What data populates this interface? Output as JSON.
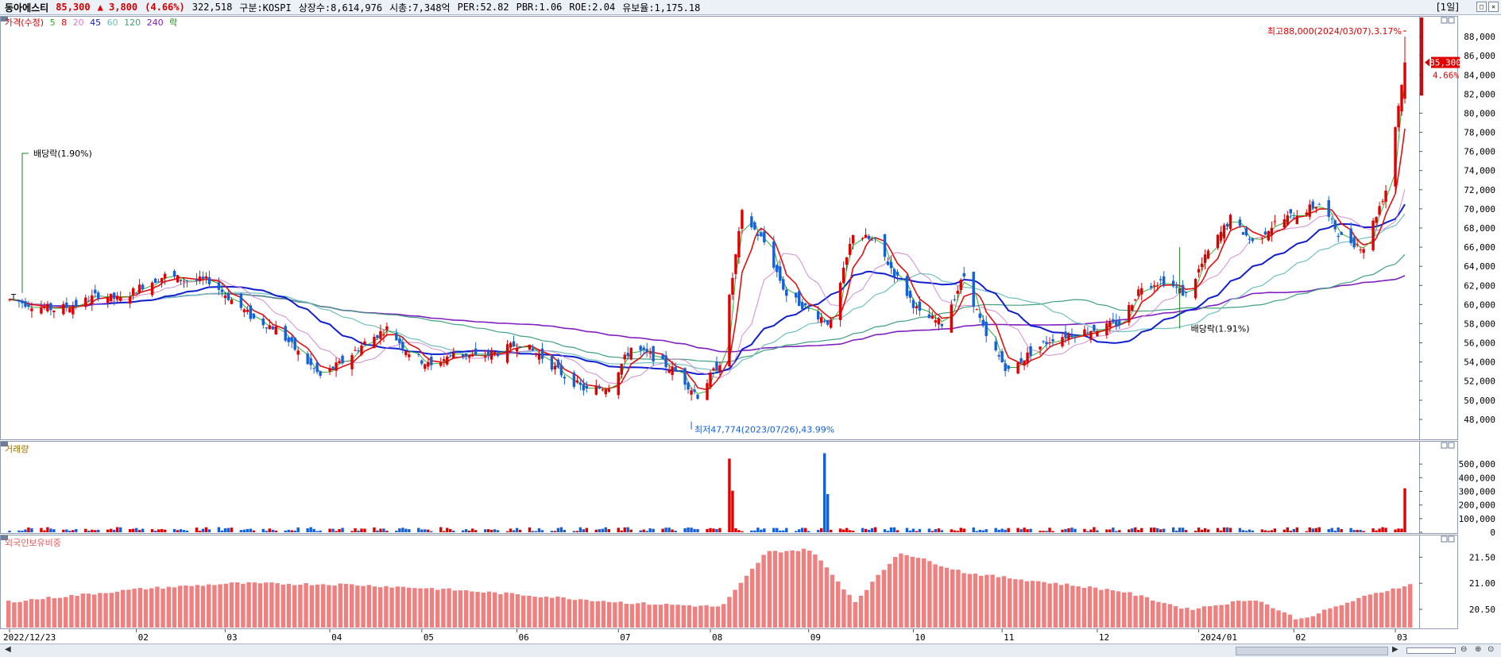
{
  "header": {
    "stock_name": "동아에스티",
    "price": "85,300",
    "change": "▲ 3,800",
    "change_pct": "(4.66%)",
    "volume": "322,518",
    "market": "구분:KOSPI",
    "shares": "상장수:8,614,976",
    "mktcap": "시총:7,348억",
    "per": "PER:52.82",
    "pbr": "PBR:1.06",
    "roe": "ROE:2.04",
    "float": "유보율:1,175.18",
    "period": "[1일]"
  },
  "legend": {
    "price_label": "가격(수정)",
    "ma5": "5",
    "ma8": "8",
    "ma20": "20",
    "ma45": "45",
    "ma60": "60",
    "ma120": "120",
    "ma240": "240",
    "ex_div": "락"
  },
  "volume_panel": {
    "title": "거래량"
  },
  "foreign_panel": {
    "title": "외국인보유비중"
  },
  "annotations": {
    "high": "최고88,000(2024/03/07),3.17%",
    "low": "최저47,774(2023/07/26),43.99%",
    "div1": "배당락(1.90%)",
    "div2": "배당락(1.91%)",
    "current_price": "85,300",
    "current_pct": "4.66%",
    "div_marker": "T"
  },
  "colors": {
    "up": "#e00000",
    "down": "#1560d6",
    "ma5": "#22aa22",
    "ma8": "#e01010",
    "ma20": "#d080d0",
    "ma45": "#1020d0",
    "ma60": "#70c0c0",
    "ma120": "#40a080",
    "ma240": "#8020c0",
    "foreign": "#f08080"
  },
  "chart_data": [
    {
      "type": "candlestick",
      "title": "가격(수정)",
      "x_ticks": [
        "2022/12/23",
        "02",
        "03",
        "04",
        "05",
        "06",
        "07",
        "08",
        "09",
        "10",
        "11",
        "12",
        "2024/01",
        "02",
        "03"
      ],
      "y_ticks": [
        48000,
        50000,
        52000,
        54000,
        56000,
        58000,
        60000,
        62000,
        64000,
        66000,
        68000,
        70000,
        72000,
        74000,
        76000,
        78000,
        80000,
        82000,
        84000,
        86000,
        88000
      ],
      "ylim": [
        46500,
        89500
      ],
      "weekly_close": [
        {
          "date": "2022-12-23",
          "close": 60500
        },
        {
          "date": "2023-01-06",
          "close": 59500
        },
        {
          "date": "2023-01-13",
          "close": 60000
        },
        {
          "date": "2023-01-20",
          "close": 61000
        },
        {
          "date": "2023-01-27",
          "close": 60500
        },
        {
          "date": "2023-02-03",
          "close": 62000
        },
        {
          "date": "2023-02-10",
          "close": 63000
        },
        {
          "date": "2023-02-17",
          "close": 62500
        },
        {
          "date": "2023-02-24",
          "close": 62500
        },
        {
          "date": "2023-03-03",
          "close": 60500
        },
        {
          "date": "2023-03-10",
          "close": 58500
        },
        {
          "date": "2023-03-17",
          "close": 57500
        },
        {
          "date": "2023-03-24",
          "close": 55000
        },
        {
          "date": "2023-03-31",
          "close": 52500
        },
        {
          "date": "2023-04-07",
          "close": 54000
        },
        {
          "date": "2023-04-14",
          "close": 56000
        },
        {
          "date": "2023-04-21",
          "close": 57500
        },
        {
          "date": "2023-04-28",
          "close": 55000
        },
        {
          "date": "2023-05-05",
          "close": 53500
        },
        {
          "date": "2023-05-12",
          "close": 55000
        },
        {
          "date": "2023-05-19",
          "close": 54500
        },
        {
          "date": "2023-05-26",
          "close": 55000
        },
        {
          "date": "2023-06-02",
          "close": 56000
        },
        {
          "date": "2023-06-09",
          "close": 54500
        },
        {
          "date": "2023-06-16",
          "close": 52500
        },
        {
          "date": "2023-06-23",
          "close": 51000
        },
        {
          "date": "2023-06-30",
          "close": 51500
        },
        {
          "date": "2023-07-07",
          "close": 55500
        },
        {
          "date": "2023-07-14",
          "close": 54500
        },
        {
          "date": "2023-07-21",
          "close": 53000
        },
        {
          "date": "2023-07-28",
          "close": 50500
        },
        {
          "date": "2023-08-04",
          "close": 54000
        },
        {
          "date": "2023-08-11",
          "close": 69500
        },
        {
          "date": "2023-08-18",
          "close": 66500
        },
        {
          "date": "2023-08-25",
          "close": 61000
        },
        {
          "date": "2023-09-01",
          "close": 59500
        },
        {
          "date": "2023-09-08",
          "close": 58000
        },
        {
          "date": "2023-09-15",
          "close": 67500
        },
        {
          "date": "2023-09-22",
          "close": 66500
        },
        {
          "date": "2023-10-06",
          "close": 59000
        },
        {
          "date": "2023-10-13",
          "close": 58000
        },
        {
          "date": "2023-10-20",
          "close": 63000
        },
        {
          "date": "2023-10-27",
          "close": 56500
        },
        {
          "date": "2023-11-03",
          "close": 53000
        },
        {
          "date": "2023-11-10",
          "close": 55000
        },
        {
          "date": "2023-11-17",
          "close": 56500
        },
        {
          "date": "2023-11-24",
          "close": 57000
        },
        {
          "date": "2023-12-01",
          "close": 57500
        },
        {
          "date": "2023-12-08",
          "close": 58000
        },
        {
          "date": "2023-12-15",
          "close": 62000
        },
        {
          "date": "2023-12-22",
          "close": 62500
        },
        {
          "date": "2023-12-29",
          "close": 61000
        },
        {
          "date": "2024-01-05",
          "close": 65500
        },
        {
          "date": "2024-01-12",
          "close": 69000
        },
        {
          "date": "2024-01-19",
          "close": 66500
        },
        {
          "date": "2024-01-26",
          "close": 68500
        },
        {
          "date": "2024-02-02",
          "close": 69500
        },
        {
          "date": "2024-02-09",
          "close": 70500
        },
        {
          "date": "2024-02-16",
          "close": 67000
        },
        {
          "date": "2024-02-23",
          "close": 66000
        },
        {
          "date": "2024-03-01",
          "close": 72000
        },
        {
          "date": "2024-03-07",
          "close": 85300
        }
      ],
      "high": {
        "value": 88000,
        "date": "2024/03/07"
      },
      "low": {
        "value": 47774,
        "date": "2023/07/26"
      },
      "moving_averages": [
        "5",
        "8",
        "20",
        "45",
        "60",
        "120",
        "240"
      ]
    },
    {
      "type": "bar",
      "title": "거래량",
      "y_ticks": [
        0,
        100000,
        200000,
        300000,
        400000,
        500000
      ],
      "ylim": [
        0,
        600000
      ],
      "spikes": [
        {
          "date": "2023-08-07",
          "value": 540000
        },
        {
          "date": "2023-08-08",
          "value": 305000
        },
        {
          "date": "2023-09-06",
          "value": 580000
        },
        {
          "date": "2023-09-07",
          "value": 280000
        },
        {
          "date": "2024-03-07",
          "value": 322518
        }
      ]
    },
    {
      "type": "bar",
      "title": "외국인보유비중",
      "y_ticks": [
        20.5,
        21.0,
        21.5
      ],
      "ylim": [
        20.15,
        21.75
      ],
      "weekly": [
        {
          "date": "2022-12-23",
          "value": 20.65
        },
        {
          "date": "2023-02-03",
          "value": 20.9
        },
        {
          "date": "2023-03-03",
          "value": 21.0
        },
        {
          "date": "2023-04-07",
          "value": 20.98
        },
        {
          "date": "2023-05-05",
          "value": 20.9
        },
        {
          "date": "2023-06-02",
          "value": 20.78
        },
        {
          "date": "2023-07-07",
          "value": 20.62
        },
        {
          "date": "2023-08-04",
          "value": 20.55
        },
        {
          "date": "2023-08-18",
          "value": 21.6
        },
        {
          "date": "2023-09-01",
          "value": 21.65
        },
        {
          "date": "2023-09-15",
          "value": 20.65
        },
        {
          "date": "2023-09-29",
          "value": 21.6
        },
        {
          "date": "2023-10-20",
          "value": 21.2
        },
        {
          "date": "2023-11-10",
          "value": 21.05
        },
        {
          "date": "2023-12-08",
          "value": 20.85
        },
        {
          "date": "2023-12-29",
          "value": 20.5
        },
        {
          "date": "2024-01-19",
          "value": 20.7
        },
        {
          "date": "2024-02-02",
          "value": 20.3
        },
        {
          "date": "2024-02-23",
          "value": 20.75
        },
        {
          "date": "2024-03-07",
          "value": 20.97
        }
      ]
    }
  ]
}
